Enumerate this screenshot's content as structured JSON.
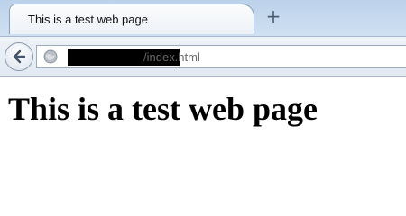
{
  "tab": {
    "title": "This is a test web page"
  },
  "toolbar": {
    "new_tab_icon": "plus-icon",
    "back_icon": "back-arrow-icon",
    "site_icon": "globe-icon",
    "url_path": "/index.html"
  },
  "page": {
    "heading": "This is a test web page"
  }
}
